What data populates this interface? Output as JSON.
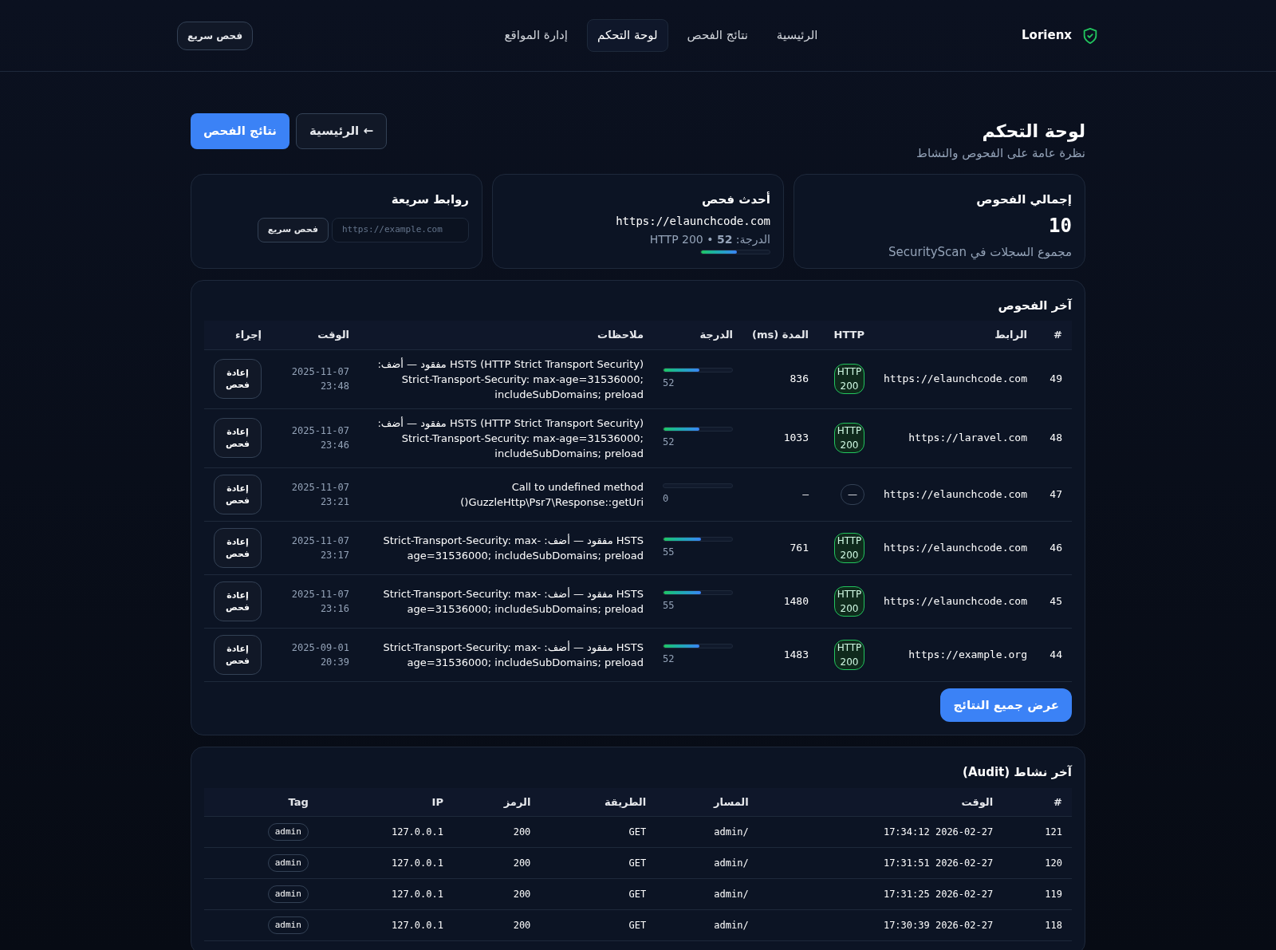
{
  "brand": {
    "name": "Lorienx"
  },
  "nav": [
    {
      "label": "الرئيسية",
      "selected": false
    },
    {
      "label": "نتائج الفحص",
      "selected": false
    },
    {
      "label": "لوحة التحكم",
      "selected": true
    },
    {
      "label": "إدارة المواقع",
      "selected": false
    }
  ],
  "nav_button": "فحص سريع",
  "header": {
    "title": "لوحة التحكم",
    "subtitle": "نظرة عامة على الفحوص والنشاط",
    "buttons": [
      {
        "label": "← الرئيسية",
        "kind": "secondary"
      },
      {
        "label": "نتائج الفحص",
        "kind": "primary"
      }
    ]
  },
  "cards": {
    "total": {
      "title": "إجمالي الفحوص",
      "value": "10",
      "note": "مجموع السجلات في SecurityScan"
    },
    "latest": {
      "title": "أحدث فحص",
      "url": "https://elaunchcode.com",
      "score_text": "الدرجة: **52** • HTTP 200",
      "level": 0.52
    },
    "quick": {
      "title": "روابط سريعة",
      "placeholder": "https://example.com",
      "button": "فحص سريع"
    }
  },
  "scans": {
    "title": "آخر الفحوص",
    "columns": [
      "#",
      "الرابط",
      "HTTP",
      "المدة (ms)",
      "الدرجة",
      "ملاحظات",
      "الوقت",
      "إجراء"
    ],
    "rows": [
      {
        "id": "49",
        "url": "https://elaunchcode.com",
        "http": "HTTP 200",
        "kind": "ok",
        "duration": "836",
        "score": "52",
        "level": 0.52,
        "note": "HSTS (HTTP Strict Transport Security) مفقود — أضف: Strict-Transport-Security: max-age=31536000; includeSubDomains; preload",
        "time": "2025-11-07 23:48",
        "action": "إعادة فحص"
      },
      {
        "id": "48",
        "url": "https://laravel.com",
        "http": "HTTP 200",
        "kind": "ok",
        "duration": "1033",
        "score": "52",
        "level": 0.52,
        "note": "HSTS (HTTP Strict Transport Security) مفقود — أضف: Strict-Transport-Security: max-age=31536000; includeSubDomains; preload",
        "time": "2025-11-07 23:46",
        "action": "إعادة فحص"
      },
      {
        "id": "47",
        "url": "https://elaunchcode.com",
        "http": "—",
        "kind": "none",
        "duration": "–",
        "score": "0",
        "level": 0,
        "note": "Call to undefined method GuzzleHttp\\Psr7\\Response::getUri()",
        "time": "2025-11-07 23:21",
        "action": "إعادة فحص"
      },
      {
        "id": "46",
        "url": "https://elaunchcode.com",
        "http": "HTTP 200",
        "kind": "ok",
        "duration": "761",
        "score": "55",
        "level": 0.55,
        "note": "HSTS مفقود — أضف: Strict-Transport-Security: max-age=31536000; includeSubDomains; preload",
        "time": "2025-11-07 23:17",
        "action": "إعادة فحص"
      },
      {
        "id": "45",
        "url": "https://elaunchcode.com",
        "http": "HTTP 200",
        "kind": "ok",
        "duration": "1480",
        "score": "55",
        "level": 0.55,
        "note": "HSTS مفقود — أضف: Strict-Transport-Security: max-age=31536000; includeSubDomains; preload",
        "time": "2025-11-07 23:16",
        "action": "إعادة فحص"
      },
      {
        "id": "44",
        "url": "https://example.org",
        "http": "HTTP 200",
        "kind": "ok",
        "duration": "1483",
        "score": "52",
        "level": 0.52,
        "note": "HSTS مفقود — أضف: Strict-Transport-Security: max-age=31536000; includeSubDomains; preload",
        "time": "2025-09-01 20:39",
        "action": "إعادة فحص"
      }
    ],
    "all_button": "عرض جميع النتائج"
  },
  "audit": {
    "title": "آخر نشاط (Audit)",
    "columns": [
      "#",
      "الوقت",
      "المسار",
      "الطريقة",
      "الرمز",
      "IP",
      "Tag"
    ],
    "rows": [
      {
        "id": "121",
        "time": "2026-02-27 17:34:12",
        "path": "/admin",
        "method": "GET",
        "code": "200",
        "ip": "127.0.0.1",
        "tag": "admin"
      },
      {
        "id": "120",
        "time": "2026-02-27 17:31:51",
        "path": "/admin",
        "method": "GET",
        "code": "200",
        "ip": "127.0.0.1",
        "tag": "admin"
      },
      {
        "id": "119",
        "time": "2026-02-27 17:31:25",
        "path": "/admin",
        "method": "GET",
        "code": "200",
        "ip": "127.0.0.1",
        "tag": "admin"
      },
      {
        "id": "118",
        "time": "2026-02-27 17:30:39",
        "path": "/admin",
        "method": "GET",
        "code": "200",
        "ip": "127.0.0.1",
        "tag": "admin"
      }
    ]
  }
}
